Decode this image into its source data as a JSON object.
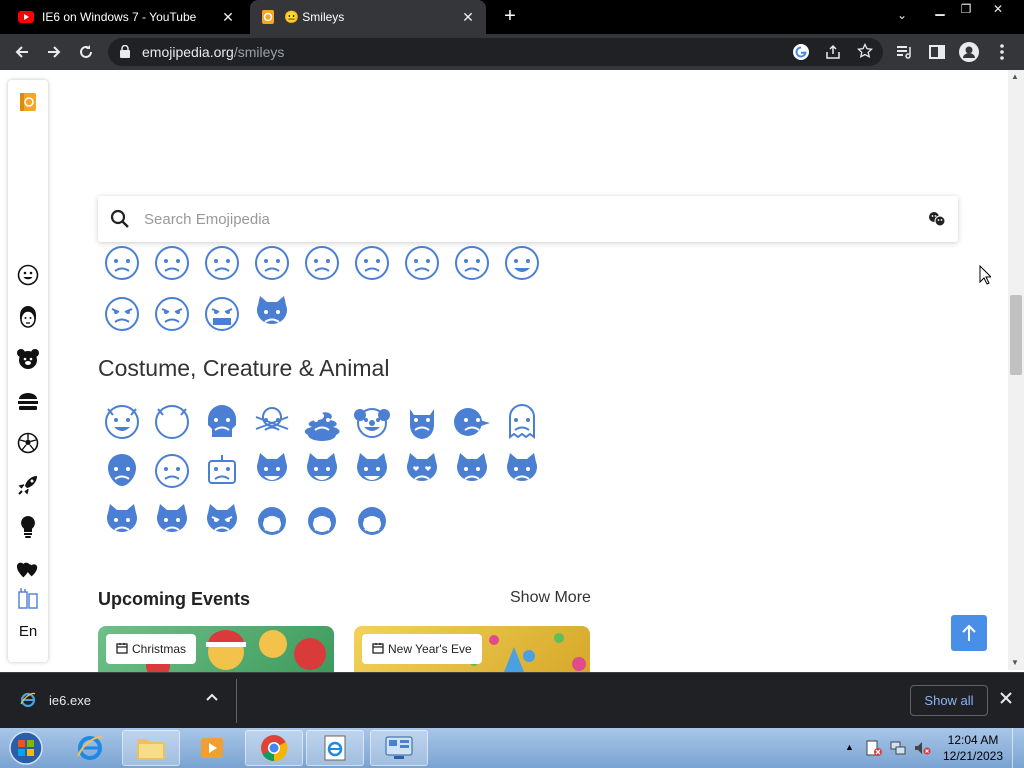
{
  "browser": {
    "tabs": [
      {
        "title": "IE6 on Windows 7 - YouTube",
        "favicon": "youtube-icon",
        "active": false
      },
      {
        "title": "😐 Smileys",
        "favicon": "emojipedia-icon",
        "active": true
      }
    ],
    "url_host": "emojipedia.org",
    "url_path": "/smileys"
  },
  "page": {
    "search_placeholder": "Search Emojipedia",
    "section_title": "Costume, Creature & Animal",
    "events_title": "Upcoming Events",
    "show_more": "Show More",
    "event_cards": [
      {
        "label": "Christmas",
        "icon": "calendar-icon"
      },
      {
        "label": "New Year's Eve",
        "icon": "calendar-icon"
      }
    ],
    "sidebar_language": "En",
    "sidebar_icons": [
      "smileys-icon",
      "people-icon",
      "animals-icon",
      "food-icon",
      "activities-icon",
      "travel-icon",
      "objects-icon",
      "symbols-icon",
      "flags-icon"
    ],
    "emoji_color": "#4a7fd4",
    "emoji_rows": {
      "smileys_row1": [
        "anguished",
        "fearful",
        "hushed",
        "confounded",
        "frowning",
        "weary",
        "persevering",
        "saluting",
        "grinning-sweat"
      ],
      "smileys_row2": [
        "pouting",
        "angry-steam",
        "cursing",
        "smiling-imp-cat"
      ],
      "creature_row1": [
        "smiling-imp",
        "imp",
        "skull",
        "skull-crossbones",
        "poop",
        "clown",
        "ogre",
        "goblin",
        "ghost"
      ],
      "creature_row2": [
        "alien",
        "alien-monster",
        "robot",
        "grinning-cat",
        "smiley-cat",
        "cat-joy",
        "heart-eyes-cat",
        "smirk-cat",
        "kissing-cat"
      ],
      "creature_row3": [
        "scream-cat",
        "crying-cat",
        "pouting-cat",
        "see-no-evil",
        "hear-no-evil",
        "speak-no-evil"
      ]
    }
  },
  "downloads": {
    "file": "ie6.exe",
    "show_all": "Show all"
  },
  "taskbar": {
    "time": "12:04 AM",
    "date": "12/21/2023",
    "items": [
      "ie-icon",
      "explorer-icon",
      "media-player-icon",
      "chrome-icon",
      "ie6-setup-icon",
      "control-panel-icon"
    ]
  }
}
